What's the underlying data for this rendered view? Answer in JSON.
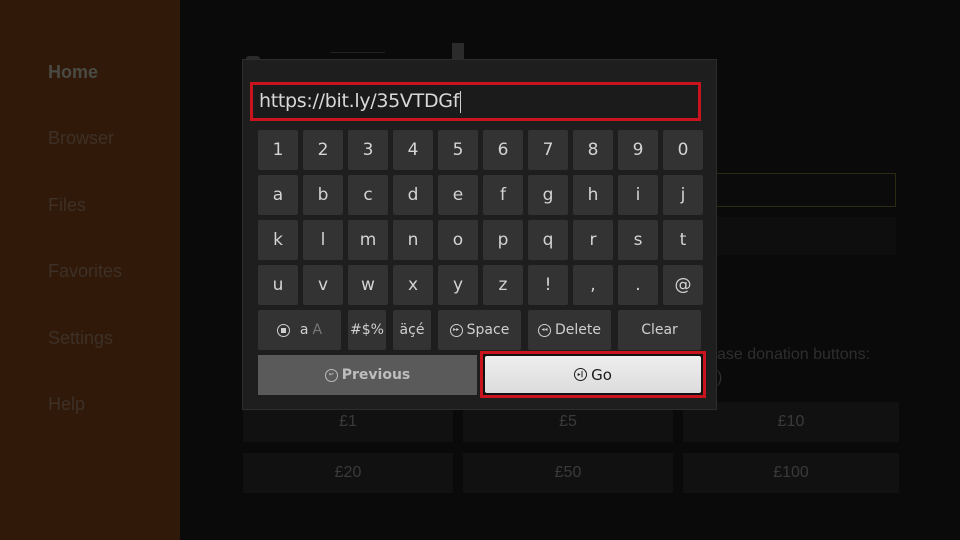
{
  "sidebar": {
    "items": [
      {
        "label": "Home",
        "active": true
      },
      {
        "label": "Browser",
        "active": false
      },
      {
        "label": "Files",
        "active": false
      },
      {
        "label": "Favorites",
        "active": false
      },
      {
        "label": "Settings",
        "active": false
      },
      {
        "label": "Help",
        "active": false
      }
    ]
  },
  "background": {
    "donation_text_line1": "ase donation buttons:",
    "donation_text_line2": ")",
    "donation_buttons": [
      "£1",
      "£5",
      "£10",
      "£20",
      "£50",
      "£100"
    ]
  },
  "keyboard": {
    "input_value": "https://bit.ly/35VTDGf",
    "rows": [
      [
        "1",
        "2",
        "3",
        "4",
        "5",
        "6",
        "7",
        "8",
        "9",
        "0"
      ],
      [
        "a",
        "b",
        "c",
        "d",
        "e",
        "f",
        "g",
        "h",
        "i",
        "j"
      ],
      [
        "k",
        "l",
        "m",
        "n",
        "o",
        "p",
        "q",
        "r",
        "s",
        "t"
      ],
      [
        "u",
        "v",
        "w",
        "x",
        "y",
        "z",
        "!",
        ",",
        ".",
        "@"
      ]
    ],
    "case_toggle": {
      "lower": "a",
      "upper": "A"
    },
    "symbols_label": "#$%",
    "accents_label": "äçé",
    "space_label": "Space",
    "delete_label": "Delete",
    "clear_label": "Clear",
    "previous_label": "Previous",
    "go_label": "Go"
  },
  "colors": {
    "highlight_border": "#c8141c",
    "sidebar_bg": "#311909",
    "key_bg": "#333333",
    "go_bg": "#e6e6e6"
  }
}
